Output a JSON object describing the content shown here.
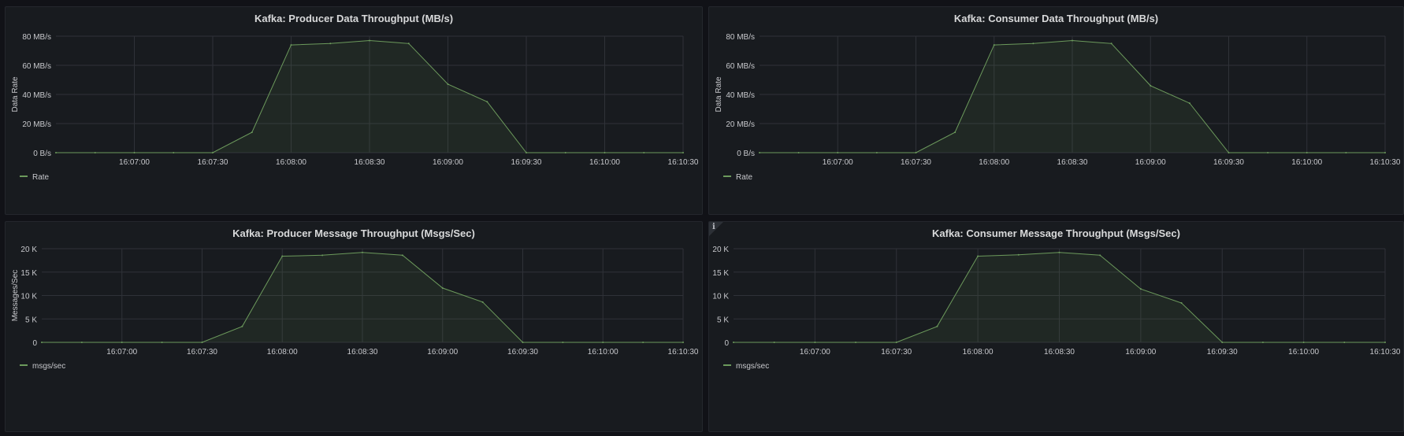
{
  "theme": {
    "background": "#111217",
    "panel_bg": "#181b1f",
    "grid_color": "#2f3238",
    "text_color": "#c7c8cc",
    "series_color": "#6c9a5c"
  },
  "panels": [
    {
      "title": "Kafka: Producer Data Throughput (MB/s)",
      "info_icon": false
    },
    {
      "title": "Kafka: Consumer Data Throughput (MB/s)",
      "info_icon": false
    },
    {
      "title": "Kafka: Producer Message Throughput (Msgs/Sec)",
      "info_icon": false
    },
    {
      "title": "Kafka: Consumer Message Throughput (Msgs/Sec)",
      "info_icon": true,
      "info_glyph": "i"
    }
  ],
  "chart_data": [
    {
      "type": "area",
      "title": "Kafka: Producer Data Throughput (MB/s)",
      "xlabel": "",
      "ylabel": "Data Rate",
      "x": [
        "16:06:30",
        "16:06:45",
        "16:07:00",
        "16:07:15",
        "16:07:30",
        "16:07:45",
        "16:08:00",
        "16:08:15",
        "16:08:30",
        "16:08:45",
        "16:09:00",
        "16:09:15",
        "16:09:30",
        "16:09:45",
        "16:10:00",
        "16:10:15",
        "16:10:30"
      ],
      "x_ticks": [
        "16:07:00",
        "16:07:30",
        "16:08:00",
        "16:08:30",
        "16:09:00",
        "16:09:30",
        "16:10:00",
        "16:10:30"
      ],
      "ylim": [
        0,
        80
      ],
      "y_ticks": [
        "0 B/s",
        "20 MB/s",
        "40 MB/s",
        "60 MB/s",
        "80 MB/s"
      ],
      "grid": true,
      "legend": "bottom-left",
      "series": [
        {
          "name": "Rate",
          "values": [
            0,
            0,
            0,
            0,
            0,
            14,
            74,
            75,
            77,
            75,
            47,
            35,
            0,
            0,
            0,
            0,
            0
          ]
        }
      ]
    },
    {
      "type": "area",
      "title": "Kafka: Consumer Data Throughput (MB/s)",
      "xlabel": "",
      "ylabel": "Data Rate",
      "x": [
        "16:06:30",
        "16:06:45",
        "16:07:00",
        "16:07:15",
        "16:07:30",
        "16:07:45",
        "16:08:00",
        "16:08:15",
        "16:08:30",
        "16:08:45",
        "16:09:00",
        "16:09:15",
        "16:09:30",
        "16:09:45",
        "16:10:00",
        "16:10:15",
        "16:10:30"
      ],
      "x_ticks": [
        "16:07:00",
        "16:07:30",
        "16:08:00",
        "16:08:30",
        "16:09:00",
        "16:09:30",
        "16:10:00",
        "16:10:30"
      ],
      "ylim": [
        0,
        80
      ],
      "y_ticks": [
        "0 B/s",
        "20 MB/s",
        "40 MB/s",
        "60 MB/s",
        "80 MB/s"
      ],
      "grid": true,
      "legend": "bottom-left",
      "series": [
        {
          "name": "Rate",
          "values": [
            0,
            0,
            0,
            0,
            0,
            14,
            74,
            75,
            77,
            75,
            46,
            34,
            0,
            0,
            0,
            0,
            0
          ]
        }
      ]
    },
    {
      "type": "area",
      "title": "Kafka: Producer Message Throughput (Msgs/Sec)",
      "xlabel": "",
      "ylabel": "Messages/Sec",
      "x": [
        "16:06:30",
        "16:06:45",
        "16:07:00",
        "16:07:15",
        "16:07:30",
        "16:07:45",
        "16:08:00",
        "16:08:15",
        "16:08:30",
        "16:08:45",
        "16:09:00",
        "16:09:15",
        "16:09:30",
        "16:09:45",
        "16:10:00",
        "16:10:15",
        "16:10:30"
      ],
      "x_ticks": [
        "16:07:00",
        "16:07:30",
        "16:08:00",
        "16:08:30",
        "16:09:00",
        "16:09:30",
        "16:10:00",
        "16:10:30"
      ],
      "ylim": [
        0,
        20000
      ],
      "y_ticks": [
        "0",
        "5 K",
        "10 K",
        "15 K",
        "20 K"
      ],
      "grid": true,
      "legend": "bottom-left",
      "series": [
        {
          "name": "msgs/sec",
          "values": [
            0,
            0,
            0,
            0,
            0,
            3400,
            18400,
            18600,
            19200,
            18600,
            11600,
            8600,
            0,
            0,
            0,
            0,
            0
          ]
        }
      ]
    },
    {
      "type": "area",
      "title": "Kafka: Consumer Message Throughput (Msgs/Sec)",
      "xlabel": "",
      "ylabel": "",
      "x": [
        "16:06:30",
        "16:06:45",
        "16:07:00",
        "16:07:15",
        "16:07:30",
        "16:07:45",
        "16:08:00",
        "16:08:15",
        "16:08:30",
        "16:08:45",
        "16:09:00",
        "16:09:15",
        "16:09:30",
        "16:09:45",
        "16:10:00",
        "16:10:15",
        "16:10:30"
      ],
      "x_ticks": [
        "16:07:00",
        "16:07:30",
        "16:08:00",
        "16:08:30",
        "16:09:00",
        "16:09:30",
        "16:10:00",
        "16:10:30"
      ],
      "ylim": [
        0,
        20000
      ],
      "y_ticks": [
        "0",
        "5 K",
        "10 K",
        "15 K",
        "20 K"
      ],
      "grid": true,
      "legend": "bottom-left",
      "series": [
        {
          "name": "msgs/sec",
          "values": [
            0,
            0,
            0,
            0,
            0,
            3400,
            18400,
            18700,
            19200,
            18600,
            11400,
            8400,
            0,
            0,
            0,
            0,
            0
          ]
        }
      ]
    }
  ]
}
